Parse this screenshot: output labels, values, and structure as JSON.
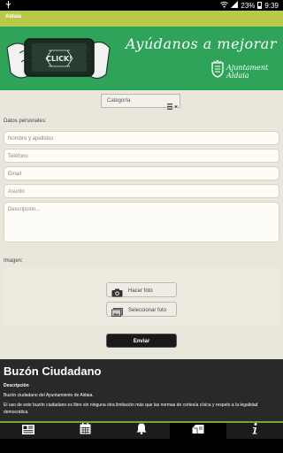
{
  "status_bar": {
    "battery": "23%",
    "time": "9:39",
    "icons": [
      "usb-icon",
      "wifi-icon",
      "cell-signal-icon",
      "battery-icon"
    ]
  },
  "app_bar": {
    "title": "Aldaia"
  },
  "banner": {
    "slogan": "Ayúdanos a mejorar",
    "phone_text": "CLICK!",
    "logo_text_line1": "Ajuntament",
    "logo_text_line2": "Aldaia"
  },
  "form": {
    "category_label": "Categoría",
    "personal_data_label": "Datos personales:",
    "fields": [
      {
        "placeholder": "Nombre y apellidos"
      },
      {
        "placeholder": "Teléfono"
      },
      {
        "placeholder": "Email"
      },
      {
        "placeholder": "Asunto"
      }
    ],
    "description_placeholder": "Descripción...",
    "images_label": "Imagen:",
    "take_photo_label": "Hacer foto",
    "select_photo_label": "Seleccionar foto",
    "send_label": "Enviar"
  },
  "info": {
    "title": "Buzón Ciudadano",
    "subtitle": "Descripción",
    "line1": "Buzón ciudadano del Ayuntamiento de Aldaia.",
    "line2": "El uso de este buzón ciudadano es libre sin ninguna otra limitación más que las normas de cortesía cívica y respeto a la legalidad democrática."
  },
  "bottom_tabs": [
    {
      "icon": "news-icon"
    },
    {
      "icon": "calendar-icon"
    },
    {
      "icon": "bell-icon"
    },
    {
      "icon": "mailbox-icon",
      "active": true
    },
    {
      "icon": "info-icon"
    }
  ],
  "colors": {
    "app_bar": "#b8c94a",
    "banner": "#2fa35a",
    "accent_line": "#7fa530",
    "dark": "#292929"
  }
}
